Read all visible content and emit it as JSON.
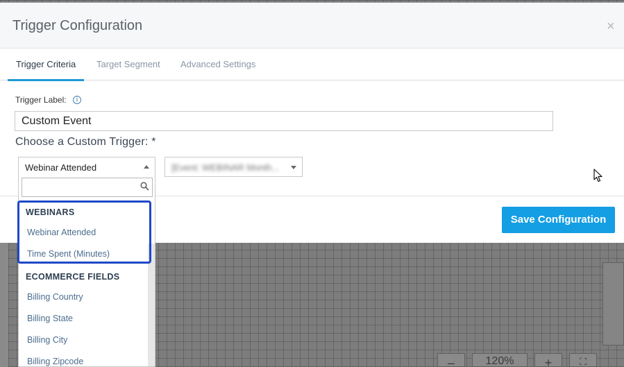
{
  "modal": {
    "title": "Trigger Configuration",
    "close_glyph": "×",
    "tabs": [
      {
        "label": "Trigger Criteria",
        "active": true
      },
      {
        "label": "Target Segment",
        "active": false
      },
      {
        "label": "Advanced Settings",
        "active": false
      }
    ]
  },
  "form": {
    "trigger_label": "Trigger Label:",
    "trigger_value": "Custom Event",
    "custom_trigger_label": "Choose a Custom Trigger: *",
    "select_primary_value": "Webinar Attended",
    "select_secondary_value": "[Event: WEBINAR Month..."
  },
  "dropdown": {
    "search_placeholder": "",
    "groups": [
      {
        "label": "WEBINARS",
        "items": [
          "Webinar Attended",
          "Time Spent (Minutes)"
        ]
      },
      {
        "label": "ECOMMERCE FIELDS",
        "items": [
          "Billing Country",
          "Billing State",
          "Billing City",
          "Billing Zipcode"
        ]
      }
    ]
  },
  "footer": {
    "save_label": "Save Configuration"
  },
  "background_toolbar": {
    "zoom": "120%"
  },
  "colors": {
    "accent": "#149ee4",
    "highlight": "#1f48c7",
    "tab_active_underline": "#1e9ad6"
  },
  "icons": [
    "close-icon",
    "info-icon",
    "caret-up-icon",
    "caret-down-icon",
    "search-icon",
    "mouse-cursor-icon"
  ]
}
